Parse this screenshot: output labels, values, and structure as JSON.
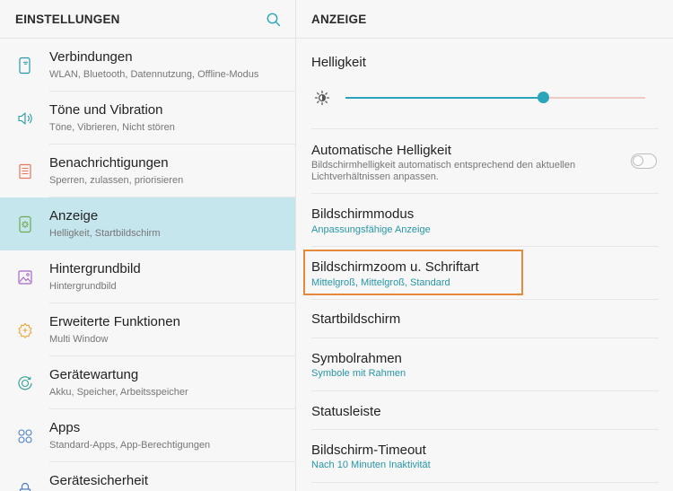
{
  "left_panel": {
    "title": "EINSTELLUNGEN",
    "items": [
      {
        "label": "Verbindungen",
        "sub": "WLAN, Bluetooth, Datennutzung, Offline-Modus",
        "icon": "connections-icon",
        "color": "#2796a8"
      },
      {
        "label": "Töne und Vibration",
        "sub": "Töne, Vibrieren, Nicht stören",
        "icon": "sound-icon",
        "color": "#2796a8"
      },
      {
        "label": "Benachrichtigungen",
        "sub": "Sperren, zulassen, priorisieren",
        "icon": "notifications-icon",
        "color": "#e9745f"
      },
      {
        "label": "Anzeige",
        "sub": "Helligkeit, Startbildschirm",
        "icon": "display-icon",
        "color": "#6dab4f",
        "active": true
      },
      {
        "label": "Hintergrundbild",
        "sub": "Hintergrundbild",
        "icon": "wallpaper-icon",
        "color": "#a867c7"
      },
      {
        "label": "Erweiterte Funktionen",
        "sub": "Multi Window",
        "icon": "advanced-features-icon",
        "color": "#f0a63a"
      },
      {
        "label": "Gerätewartung",
        "sub": "Akku, Speicher, Arbeitsspeicher",
        "icon": "device-maintenance-icon",
        "color": "#34a29b"
      },
      {
        "label": "Apps",
        "sub": "Standard-Apps, App-Berechtigungen",
        "icon": "apps-icon",
        "color": "#4c7ec7"
      },
      {
        "label": "Gerätesicherheit",
        "sub": "",
        "icon": "lock-icon",
        "color": "#4c7ec7"
      }
    ]
  },
  "right_panel": {
    "title": "ANZEIGE",
    "brightness": {
      "label": "Helligkeit",
      "level": 0.66
    },
    "auto_brightness": {
      "label": "Automatische Helligkeit",
      "desc": "Bildschirmhelligkeit automatisch entsprechend den aktuellen Lichtverhältnissen anpassen.",
      "enabled": false
    },
    "screen_mode": {
      "label": "Bildschirmmodus",
      "sub": "Anpassungsfähige Anzeige"
    },
    "zoom_font": {
      "label": "Bildschirmzoom u. Schriftart",
      "sub": "Mittelgroß, Mittelgroß, Standard"
    },
    "home_screen": {
      "label": "Startbildschirm"
    },
    "icon_frames": {
      "label": "Symbolrahmen",
      "sub": "Symbole mit Rahmen"
    },
    "status_bar": {
      "label": "Statusleiste"
    },
    "screen_timeout": {
      "label": "Bildschirm-Timeout",
      "sub": "Nach 10 Minuten Inaktivität"
    }
  },
  "colors": {
    "accent": "#2aa4ba",
    "active_bg": "#c6e6ee",
    "highlight": "#e58a3a"
  }
}
